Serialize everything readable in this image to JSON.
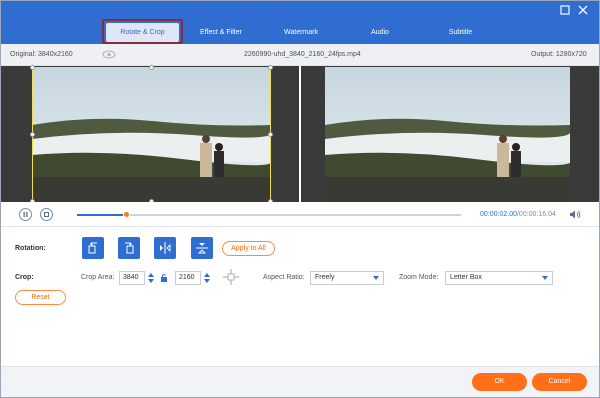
{
  "tabs": [
    {
      "label": "Rotate & Crop",
      "active": true
    },
    {
      "label": "Effect & Filter",
      "active": false
    },
    {
      "label": "Watermark",
      "active": false
    },
    {
      "label": "Audio",
      "active": false
    },
    {
      "label": "Subtitle",
      "active": false
    }
  ],
  "window_controls": {
    "maximize_icon": "maximize-icon",
    "close_icon": "close-icon"
  },
  "info": {
    "original": "Original: 3840x2160",
    "filename": "2260990-uhd_3840_2160_24fps.mp4",
    "output": "Output: 1280x720"
  },
  "playback": {
    "current_time": "00:00:02.00",
    "total_time": "/00:00:16.04",
    "progress": 0.13
  },
  "rotation": {
    "label": "Rotation:",
    "buttons": [
      "rotate-left-icon",
      "rotate-right-icon",
      "flip-horizontal-icon",
      "flip-vertical-icon"
    ],
    "apply_all": "Apply to All"
  },
  "crop": {
    "label": "Crop:",
    "area_label": "Crop Area:",
    "width": "3840",
    "height": "2160",
    "aspect_label": "Aspect Ratio:",
    "aspect_value": "Freely",
    "zoom_label": "Zoom Mode:",
    "zoom_value": "Letter Box",
    "reset": "Reset"
  },
  "footer": {
    "ok": "OK",
    "cancel": "Cancel"
  },
  "colors": {
    "accent": "#2f6dd0",
    "orange": "#ff6f1a",
    "crop_frame": "#f0e050"
  }
}
